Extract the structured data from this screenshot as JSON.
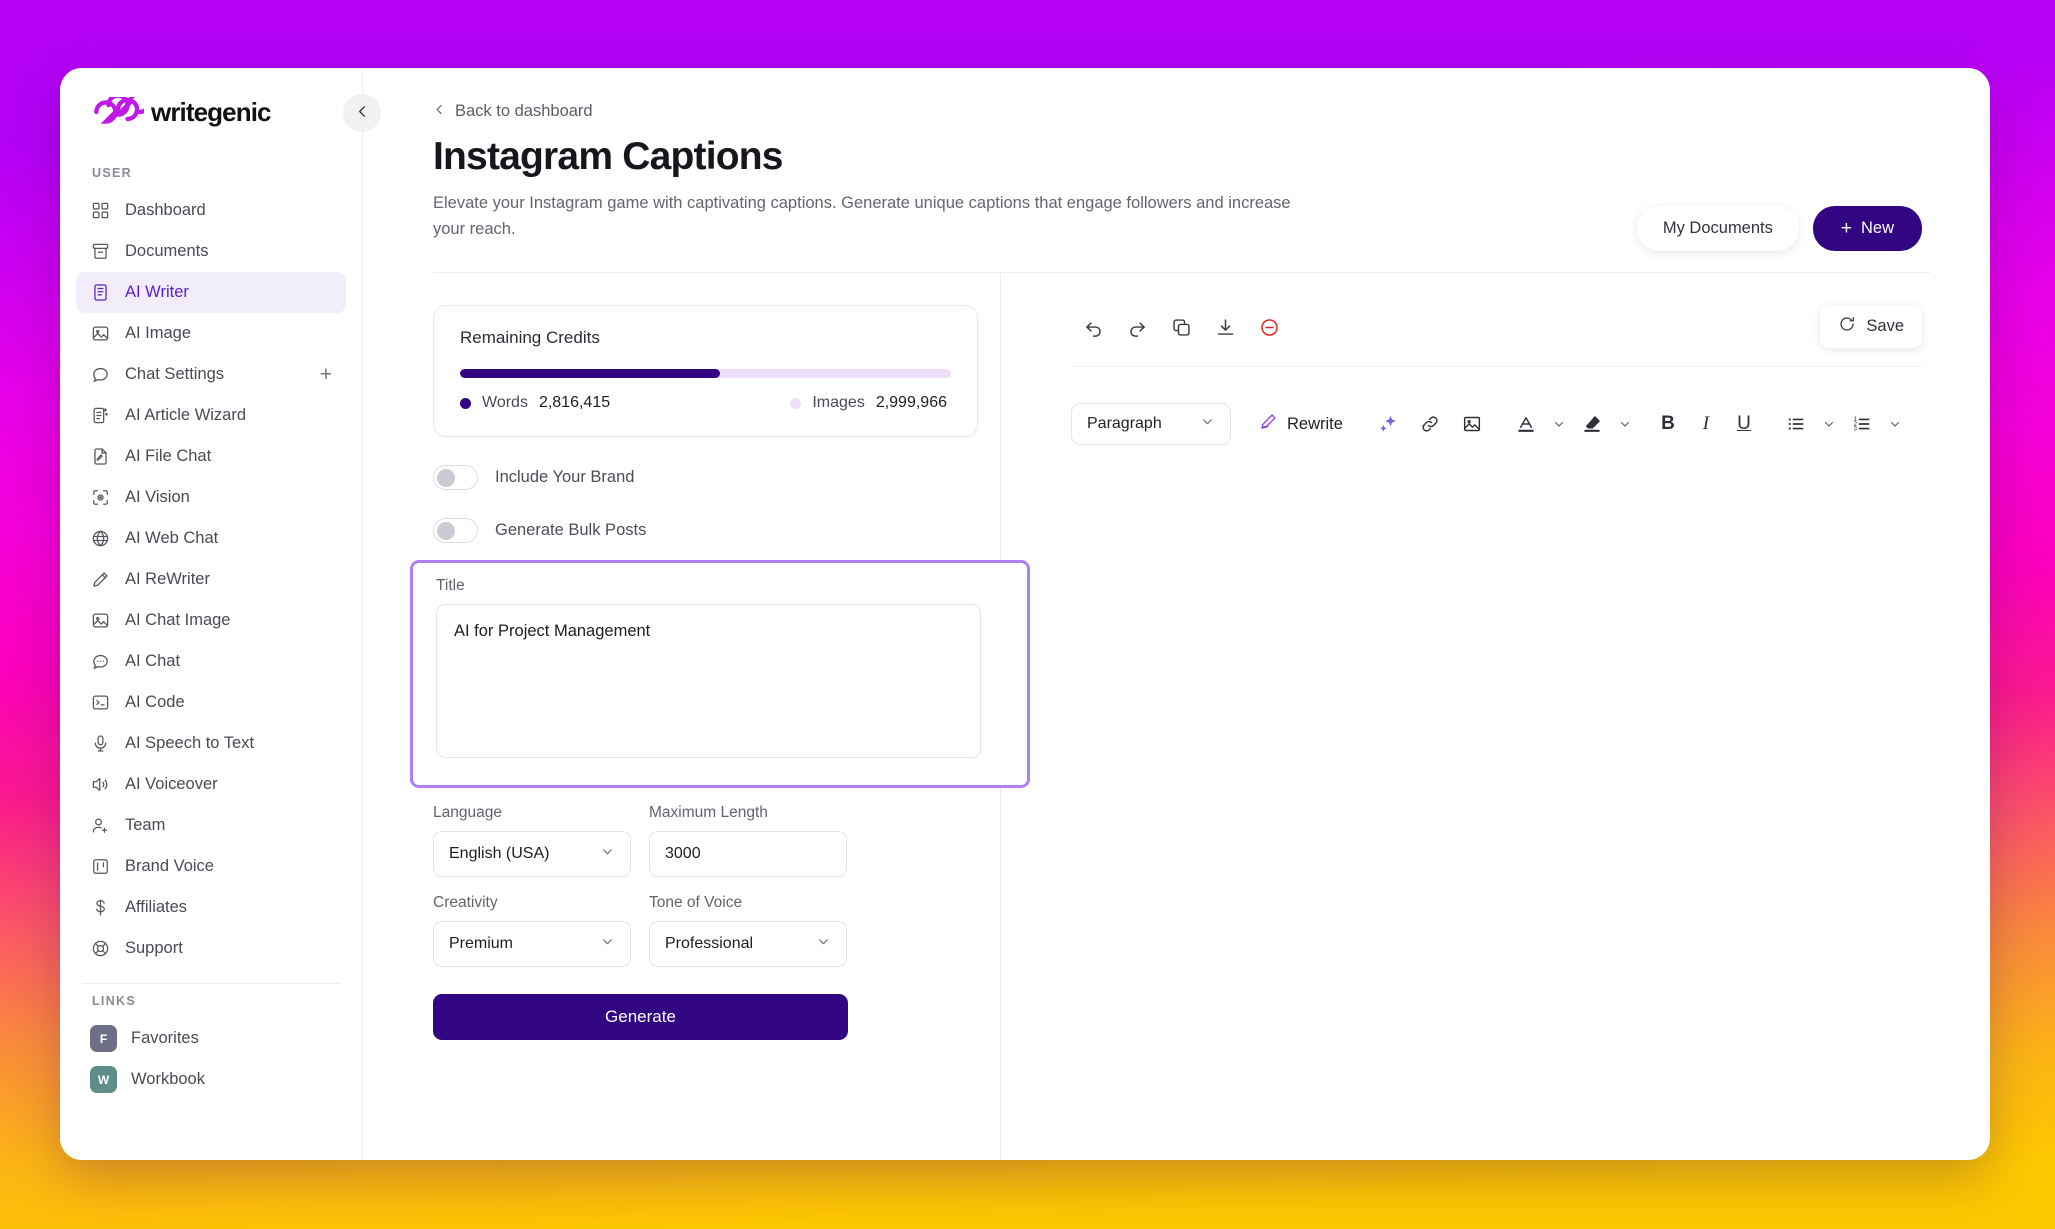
{
  "app": {
    "brand": "writegenic"
  },
  "sidebar": {
    "user_section_label": "USER",
    "links_section_label": "LINKS",
    "items": [
      {
        "label": "Dashboard",
        "icon": "grid-icon"
      },
      {
        "label": "Documents",
        "icon": "archive-icon"
      },
      {
        "label": "AI Writer",
        "icon": "document-text-icon",
        "active": true
      },
      {
        "label": "AI Image",
        "icon": "image-icon"
      },
      {
        "label": "Chat Settings",
        "icon": "chat-bubble-icon",
        "trailing": "+"
      },
      {
        "label": "AI Article Wizard",
        "icon": "article-wizard-icon"
      },
      {
        "label": "AI File Chat",
        "icon": "file-pencil-icon"
      },
      {
        "label": "AI Vision",
        "icon": "vision-scan-icon"
      },
      {
        "label": "AI Web Chat",
        "icon": "globe-www-icon"
      },
      {
        "label": "AI ReWriter",
        "icon": "pencil-icon"
      },
      {
        "label": "AI Chat Image",
        "icon": "image-icon"
      },
      {
        "label": "AI Chat",
        "icon": "chat-dots-icon"
      },
      {
        "label": "AI Code",
        "icon": "terminal-icon"
      },
      {
        "label": "AI Speech to Text",
        "icon": "microphone-icon"
      },
      {
        "label": "AI Voiceover",
        "icon": "speaker-icon"
      },
      {
        "label": "Team",
        "icon": "user-plus-icon"
      },
      {
        "label": "Brand Voice",
        "icon": "brand-board-icon"
      },
      {
        "label": "Affiliates",
        "icon": "dollar-icon"
      },
      {
        "label": "Support",
        "icon": "lifebuoy-icon"
      }
    ],
    "links": [
      {
        "label": "Favorites",
        "initial": "F",
        "color": "#6e6e87"
      },
      {
        "label": "Workbook",
        "initial": "W",
        "color": "#5f8d8a"
      }
    ]
  },
  "header": {
    "back_label": "Back to dashboard",
    "title": "Instagram Captions",
    "subtitle": "Elevate your Instagram game with captivating captions. Generate unique captions that engage followers and increase your reach.",
    "my_documents_label": "My Documents",
    "new_label": "New",
    "new_plus": "+"
  },
  "credits": {
    "title": "Remaining Credits",
    "progress_percent": 53,
    "words_label": "Words",
    "words_value": "2,816,415",
    "images_label": "Images",
    "images_value": "2,999,966",
    "words_color": "#320682",
    "images_color": "#eee0fa"
  },
  "form": {
    "include_brand_label": "Include Your Brand",
    "include_brand_on": false,
    "bulk_posts_label": "Generate Bulk Posts",
    "bulk_posts_on": false,
    "title_label": "Title",
    "title_value": "AI for Project Management",
    "title_placeholder": "Enter a title",
    "language_label": "Language",
    "language_value": "English (USA)",
    "max_length_label": "Maximum Length",
    "max_length_value": "3000",
    "creativity_label": "Creativity",
    "creativity_value": "Premium",
    "tone_label": "Tone of Voice",
    "tone_value": "Professional",
    "generate_label": "Generate",
    "highlight_color": "#b07ff0"
  },
  "editor": {
    "top_tools": [
      {
        "name": "undo-icon"
      },
      {
        "name": "redo-icon"
      },
      {
        "name": "copy-icon"
      },
      {
        "name": "download-icon"
      },
      {
        "name": "clear-icon"
      }
    ],
    "save_label": "Save",
    "paragraph_value": "Paragraph",
    "rewrite_label": "Rewrite",
    "format_tools": [
      {
        "name": "sparkle-ai-icon"
      },
      {
        "name": "link-icon"
      },
      {
        "name": "image-insert-icon"
      },
      {
        "name": "text-color-icon"
      },
      {
        "name": "highlighter-icon"
      },
      {
        "name": "bold-icon",
        "glyph": "B"
      },
      {
        "name": "italic-icon",
        "glyph": "I"
      },
      {
        "name": "underline-icon",
        "glyph": "U"
      },
      {
        "name": "bullet-list-icon"
      },
      {
        "name": "numbered-list-icon"
      }
    ]
  },
  "theme": {
    "accent": "#320682",
    "brand_purple": "#c018e8",
    "danger": "#e02424"
  }
}
